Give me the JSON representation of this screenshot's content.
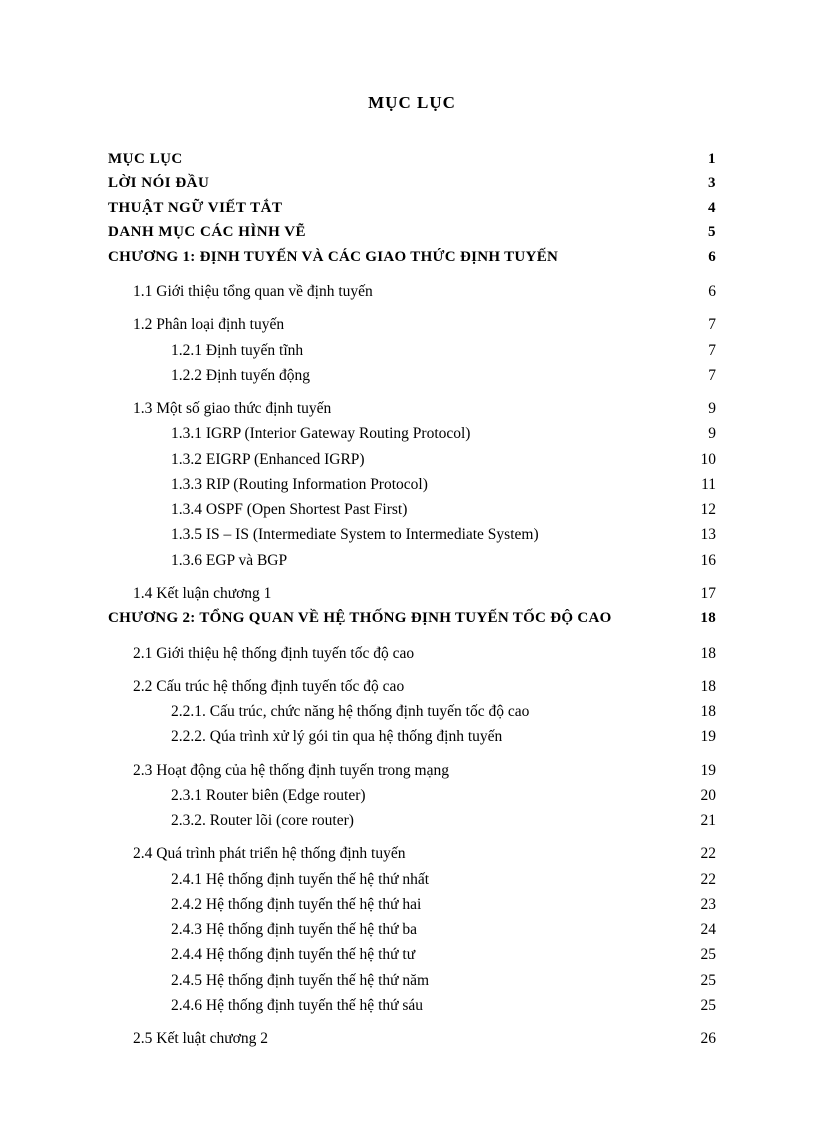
{
  "title": "MỤC LỤC",
  "front": [
    {
      "label": "MỤC LỤC",
      "page": "1"
    },
    {
      "label": "LỜI NÓI ĐẦU",
      "page": "3"
    },
    {
      "label": "THUẬT  NGỮ VIẾT TẮT",
      "page": "4"
    },
    {
      "label": "DANH MỤC CÁC HÌNH VẼ",
      "page": "5"
    }
  ],
  "chapters": [
    {
      "label": "CHƯƠNG 1: ĐỊNH TUYẾN  VÀ CÁC GIAO THỨC ĐỊNH TUYẾN",
      "page": "6"
    },
    {
      "label": "CHƯƠNG 2: TỔNG QUAN  VỀ HỆ THỐNG ĐỊNH TUYẾN  TỐC ĐỘ CAO",
      "page": "18"
    }
  ],
  "s": {
    "s11": {
      "label": "1.1  Giới thiệu tổng quan về định tuyến",
      "page": "6"
    },
    "s12": {
      "label": "1.2  Phân loại định tuyến",
      "page": "7"
    },
    "s121": {
      "label": "1.2.1 Định tuyến tĩnh",
      "page": "7"
    },
    "s122": {
      "label": "1.2.2 Định tuyến động",
      "page": "7"
    },
    "s13": {
      "label": "1.3  Một số giao thức định tuyến",
      "page": "9"
    },
    "s131": {
      "label": "1.3.1   IGRP (Interior Gateway  Routing Protocol)",
      "page": "9"
    },
    "s132": {
      "label": "1.3.2   EIGRP (Enhanced IGRP)",
      "page": "10"
    },
    "s133": {
      "label": "1.3.3   RIP (Routing Information Protocol)",
      "page": "11"
    },
    "s134": {
      "label": "1.3.4   OSPF (Open Shortest Past First)",
      "page": "12"
    },
    "s135": {
      "label": "1.3.5    IS – IS (Intermediate System to Intermediate System)",
      "page": "13"
    },
    "s136": {
      "label": "1.3.6 EGP và BGP",
      "page": "16"
    },
    "s14": {
      "label": "1.4  Kết luận chương 1",
      "page": "17"
    },
    "s21": {
      "label": "2.1  Giới thiệu hệ thống định tuyến tốc độ cao",
      "page": "18"
    },
    "s22": {
      "label": "2.2  Cấu trúc hệ thống định tuyến tốc độ cao",
      "page": "18"
    },
    "s221": {
      "label": "2.2.1. Cấu trúc, chức năng hệ thống định tuyến tốc độ cao",
      "page": "18"
    },
    "s222": {
      "label": "2.2.2. Qúa trình xử lý gói tin qua hệ thống định tuyến",
      "page": "19"
    },
    "s23": {
      "label": "2.3  Hoạt động của hệ thống định tuyến trong mạng",
      "page": "19"
    },
    "s231": {
      "label": "2.3.1 Router biên (Edge router)",
      "page": "20"
    },
    "s232": {
      "label": "2.3.2. Router lõi (core router)",
      "page": "21"
    },
    "s24": {
      "label": "2.4  Quá trình phát triển hệ thống định tuyến",
      "page": "22"
    },
    "s241": {
      "label": "2.4.1 Hệ thống định tuyến thế hệ thứ nhất",
      "page": "22"
    },
    "s242": {
      "label": "2.4.2 Hệ thống định tuyến thế hệ thứ hai",
      "page": "23"
    },
    "s243": {
      "label": "2.4.3 Hệ thống định tuyến thế hệ thứ ba",
      "page": "24"
    },
    "s244": {
      "label": "2.4.4 Hệ thống định tuyến thế hệ thứ tư",
      "page": "25"
    },
    "s245": {
      "label": "2.4.5 Hệ thống định tuyến thế hệ thứ năm",
      "page": "25"
    },
    "s246": {
      "label": "2.4.6 Hệ thống định tuyến thế hệ thứ sáu",
      "page": "25"
    },
    "s25": {
      "label": "2.5 Kết luật chương 2",
      "page": "26"
    }
  }
}
